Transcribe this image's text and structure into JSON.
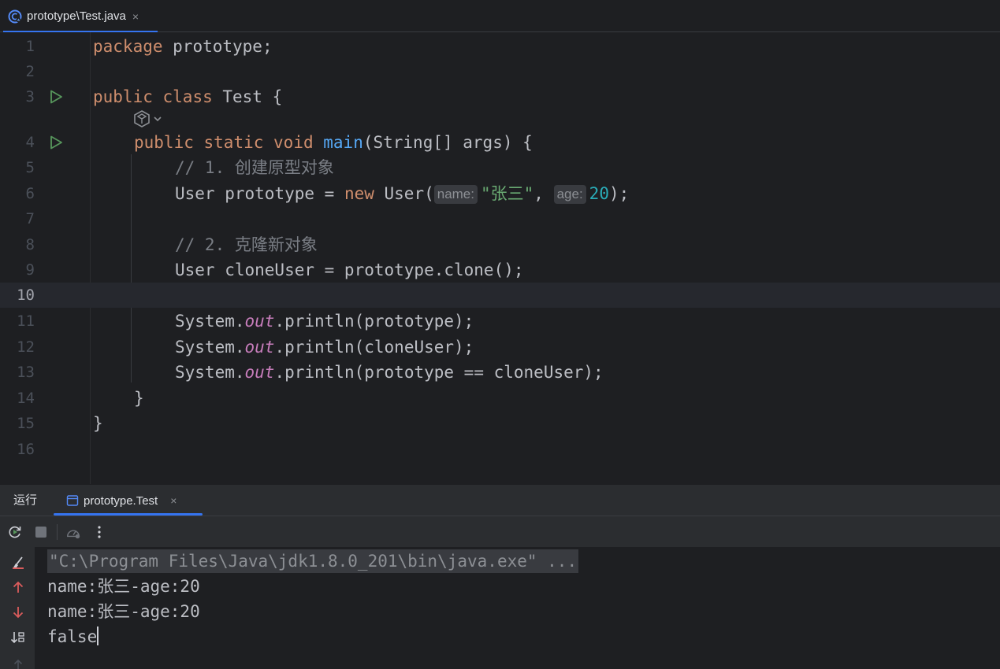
{
  "editor_tab": {
    "label": "prototype\\Test.java",
    "close": "×"
  },
  "editor": {
    "line_numbers": [
      "1",
      "2",
      "3",
      "4",
      "5",
      "6",
      "7",
      "8",
      "9",
      "10",
      "11",
      "12",
      "13",
      "14",
      "15",
      "16"
    ],
    "line1": {
      "kw": "package",
      "rest": " prototype;"
    },
    "line3": {
      "kw1": "public",
      "kw2": "class",
      "rest": " Test {"
    },
    "line4": {
      "kw1": "public",
      "kw2": "static",
      "kw3": "void",
      "fn": "main",
      "rest": "(String[] args) {"
    },
    "line5": {
      "comment": "// 1. 创建原型对象"
    },
    "line6": {
      "pre": "User prototype = ",
      "kw": "new",
      "ctor": " User(",
      "hint1": "name:",
      "str": "\"张三\"",
      "sep": ", ",
      "hint2": "age:",
      "num": "20",
      "end": ");"
    },
    "line8": {
      "comment": "// 2. 克隆新对象"
    },
    "line9": {
      "text": "User cloneUser = prototype.clone();"
    },
    "line11": {
      "pre": "System.",
      "field": "out",
      "post": ".println(prototype);"
    },
    "line12": {
      "pre": "System.",
      "field": "out",
      "post": ".println(cloneUser);"
    },
    "line13": {
      "pre": "System.",
      "field": "out",
      "post": ".println(prototype == cloneUser);"
    },
    "line14": {
      "text": "}"
    },
    "line15": {
      "text": "}"
    }
  },
  "run_panel": {
    "title": "运行",
    "tab_label": "prototype.Test",
    "tab_close": "×"
  },
  "console": {
    "command": "\"C:\\Program Files\\Java\\jdk1.8.0_201\\bin\\java.exe\" ...",
    "lines": [
      "name:张三-age:20",
      "name:张三-age:20",
      "false"
    ]
  },
  "colors": {
    "background": "#1e1f22",
    "panel": "#2b2d30",
    "keyword": "#cf8e6d",
    "function": "#56a8f5",
    "string": "#6aab73",
    "number": "#2aacb8",
    "static_field": "#c77dbb",
    "accent": "#3574f0",
    "run_icon": "#57965c"
  }
}
